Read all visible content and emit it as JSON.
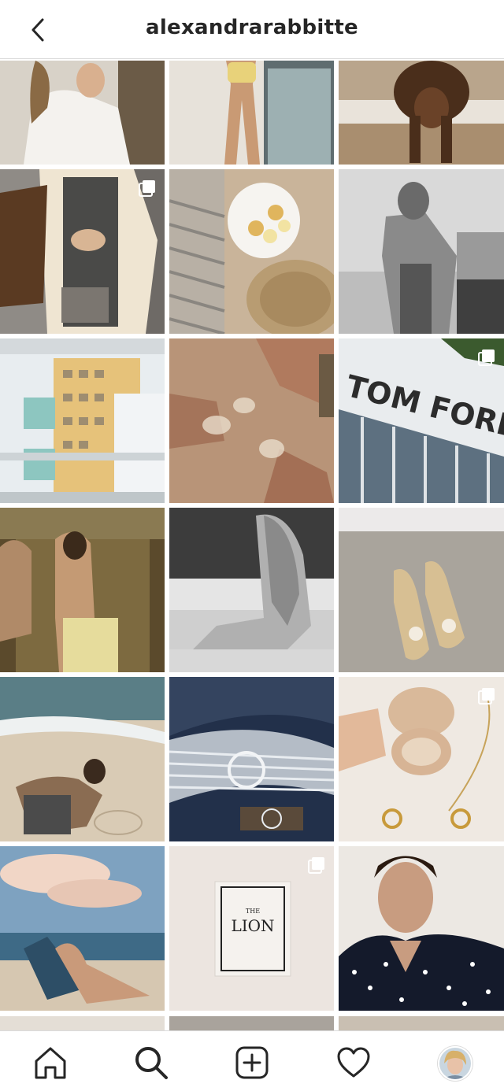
{
  "header": {
    "username": "alexandrarabbitte",
    "back_icon": "chevron-left-icon"
  },
  "grid": {
    "posts": [
      {
        "name": "post-white-shirt",
        "multi": false
      },
      {
        "name": "post-swimsuit-balcony",
        "multi": false
      },
      {
        "name": "post-dog-stairs",
        "multi": false
      },
      {
        "name": "post-trench-coat-bag",
        "multi": true
      },
      {
        "name": "post-pancakes-plate",
        "multi": false
      },
      {
        "name": "post-bw-street",
        "multi": false
      },
      {
        "name": "post-balcony-buildings",
        "multi": false
      },
      {
        "name": "post-champagne-toast",
        "multi": false
      },
      {
        "name": "post-tom-ford-store",
        "multi": true
      },
      {
        "name": "post-mirror-selfie",
        "multi": false
      },
      {
        "name": "post-bw-pool",
        "multi": false
      },
      {
        "name": "post-sandals-sand",
        "multi": false
      },
      {
        "name": "post-beach-writing",
        "multi": false
      },
      {
        "name": "post-mercedes",
        "multi": false
      },
      {
        "name": "post-jewelry-box",
        "multi": true
      },
      {
        "name": "post-beach-lounger",
        "multi": false
      },
      {
        "name": "post-the-lion-card",
        "multi": true
      },
      {
        "name": "post-polka-dot-portrait",
        "multi": false
      }
    ],
    "store_sign": "TOM FORD",
    "card_small": "THE",
    "card_big": "LION"
  },
  "nav": {
    "items": [
      {
        "name": "home-icon"
      },
      {
        "name": "search-icon",
        "active": true
      },
      {
        "name": "new-post-icon"
      },
      {
        "name": "activity-heart-icon"
      },
      {
        "name": "profile-avatar"
      }
    ]
  }
}
